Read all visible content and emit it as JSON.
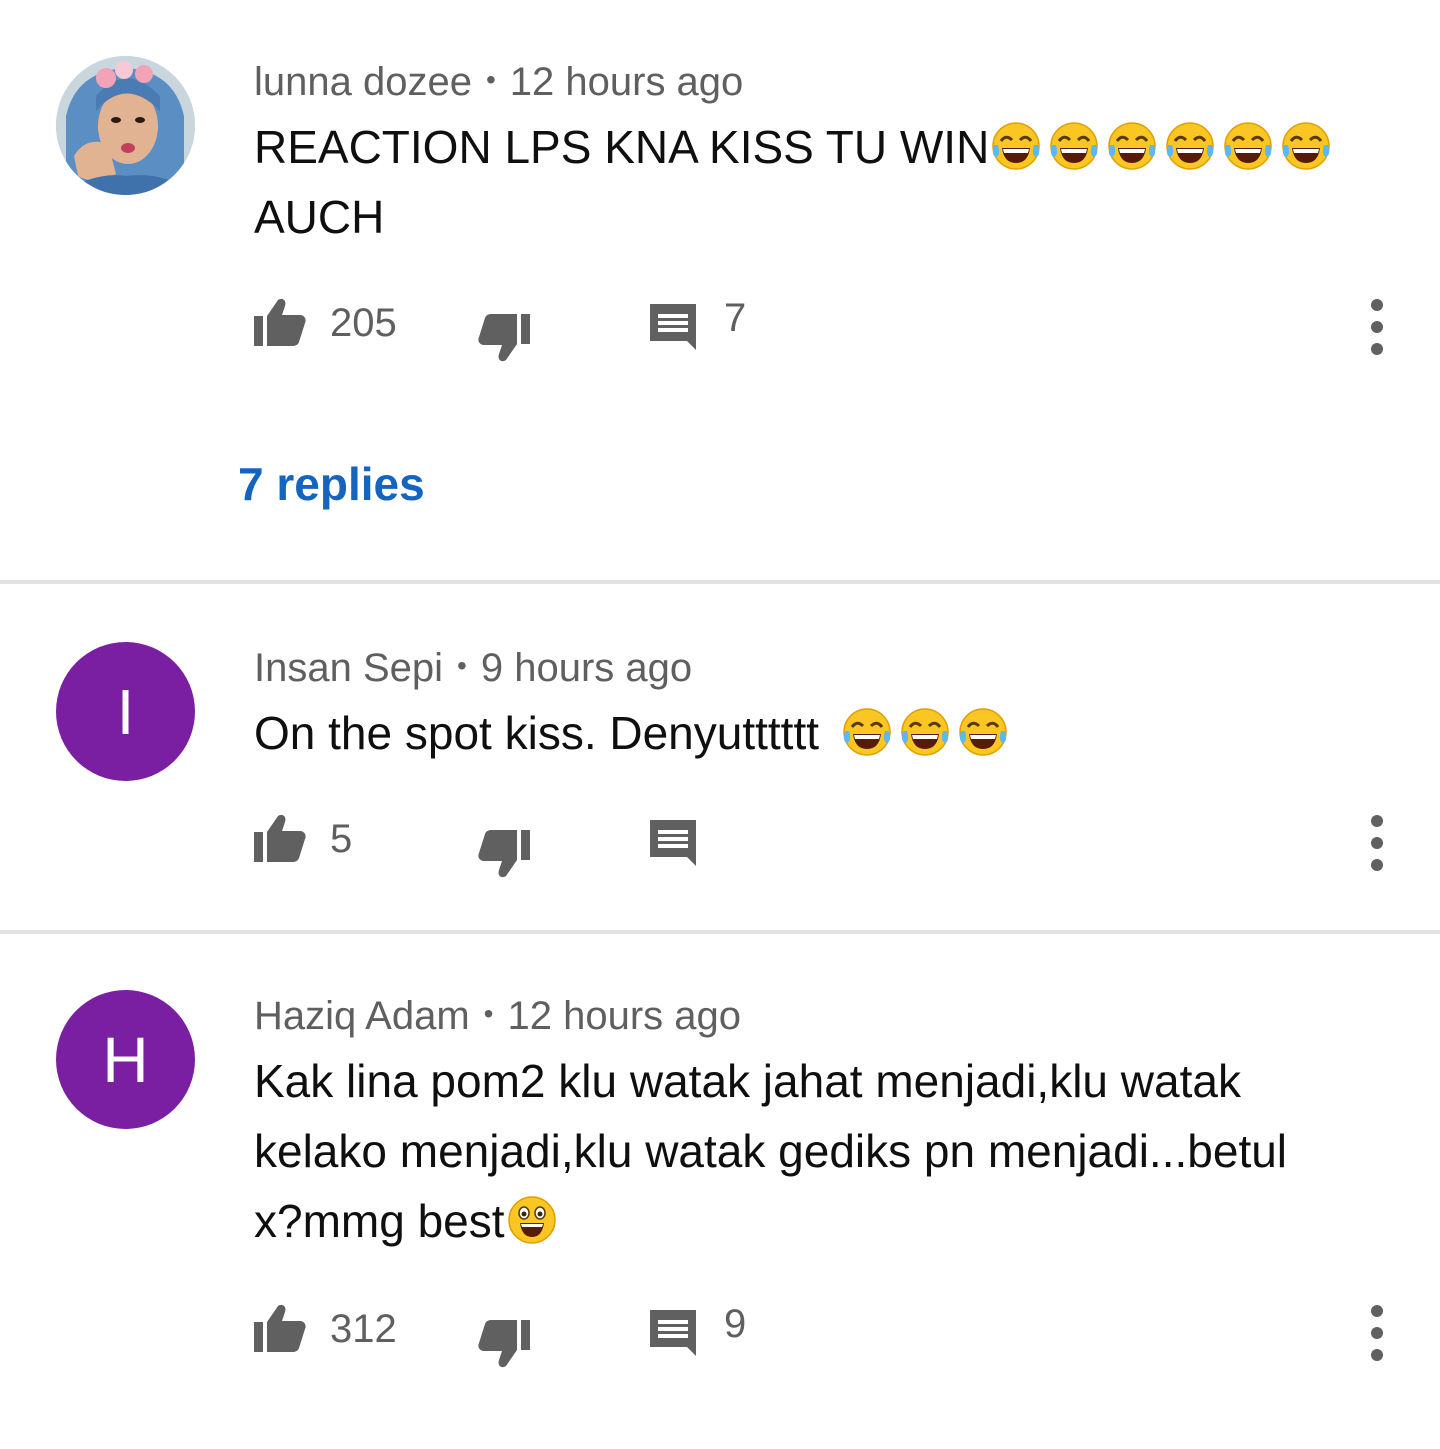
{
  "comments": [
    {
      "author": "lunna dozee",
      "time": "12 hours ago",
      "avatar": {
        "type": "photo"
      },
      "text_line1": "REACTION LPS KNA KISS TU WIN",
      "emoji_line1": [
        "face-with-tears-of-joy",
        "face-with-tears-of-joy",
        "face-with-tears-of-joy",
        "face-with-tears-of-joy",
        "face-with-tears-of-joy",
        "face-with-tears-of-joy"
      ],
      "text_line2": "AUCH",
      "likes": "205",
      "replies_count": "7",
      "replies_link": "7 replies"
    },
    {
      "author": "Insan Sepi",
      "time": "9 hours ago",
      "avatar": {
        "type": "letter",
        "letter": "I",
        "color": "#7b1fa2"
      },
      "text_line1": "On the spot kiss. Denyutttttt ",
      "emoji_line1": [
        "face-with-tears-of-joy",
        "face-with-tears-of-joy",
        "face-with-tears-of-joy"
      ],
      "likes": "5",
      "replies_count": ""
    },
    {
      "author": "Haziq Adam",
      "time": "12 hours ago",
      "avatar": {
        "type": "letter",
        "letter": "H",
        "color": "#7b1fa2"
      },
      "text_line1": "Kak lina pom2 klu watak jahat menjadi,klu watak",
      "text_line2": "kelako menjadi,klu watak gediks pn menjadi...betul",
      "text_line3": "x?mmg best",
      "emoji_line3": [
        "grinning-face-with-open-mouth"
      ],
      "likes": "312",
      "replies_count": "9"
    }
  ],
  "separator": "•",
  "icons": {
    "like": "thumbs-up-icon",
    "dislike": "thumbs-down-icon",
    "reply": "comment-icon",
    "more": "more-vert-icon"
  },
  "colors": {
    "meta": "#5f5f5f",
    "text": "#0f0f0f",
    "link": "#1565c0",
    "avatar_bg": "#7b1fa2",
    "divider": "#e2e2e2"
  }
}
